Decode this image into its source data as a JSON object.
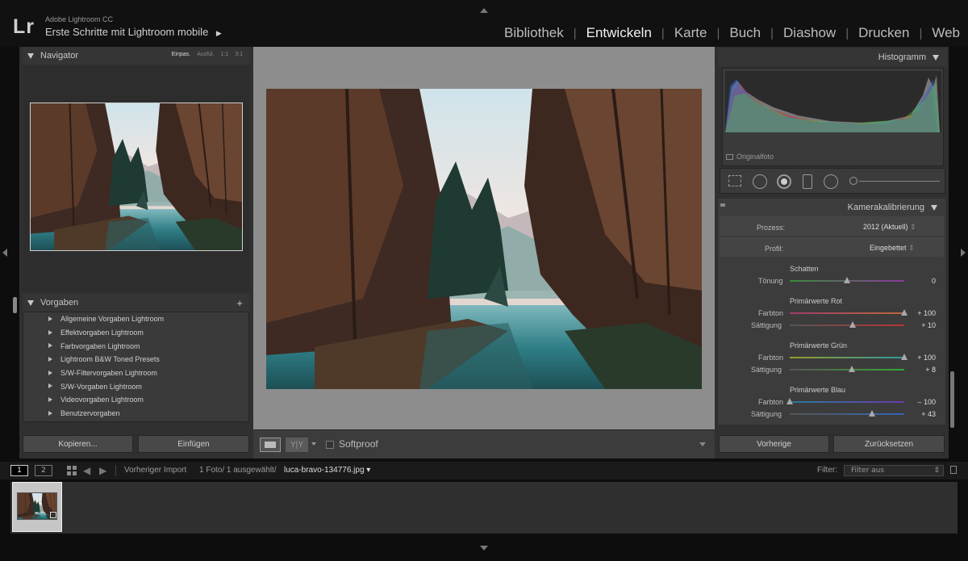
{
  "app": {
    "logo": "Lr",
    "name": "Adobe Lightroom CC",
    "catalog": "Erste Schritte mit Lightroom mobile",
    "modules": [
      "Bibliothek",
      "Entwickeln",
      "Karte",
      "Buch",
      "Diashow",
      "Drucken",
      "Web"
    ],
    "active_module": "Entwickeln"
  },
  "navigator": {
    "title": "Navigator",
    "zoom_options": [
      "Einpas.",
      "Ausfül.",
      "1:1",
      "3:1"
    ],
    "selected_zoom": "Einpas."
  },
  "presets": {
    "title": "Vorgaben",
    "add_symbol": "+",
    "items": [
      "Allgemeine Vorgaben Lightroom",
      "Effektvorgaben Lightroom",
      "Farbvorgaben Lightroom",
      "Lightroom B&W Toned Presets",
      "S/W-Filtervorgaben Lightroom",
      "S/W-Vorgaben Lightroom",
      "Videovorgaben Lightroom",
      "Benutzervorgaben"
    ]
  },
  "left_buttons": {
    "copy": "Kopieren...",
    "paste": "Einfügen"
  },
  "toolbar": {
    "softproof": "Softproof",
    "compare": "Y|Y"
  },
  "histogram": {
    "title": "Histogramm",
    "original_label": "Originalfoto"
  },
  "calibration": {
    "title": "Kamerakalibrierung",
    "process_label": "Prozess:",
    "process_value": "2012 (Aktuell)",
    "profile_label": "Profil:",
    "profile_value": "Eingebettet",
    "shadows": {
      "heading": "Schatten",
      "tint_label": "Tönung",
      "tint_value": "0",
      "tint_level": 0.5
    },
    "red": {
      "heading": "Primärwerte Rot",
      "hue_label": "Farbton",
      "hue_value": "+ 100",
      "hue_level": 1.0,
      "sat_label": "Sättigung",
      "sat_value": "+ 10",
      "sat_level": 0.55
    },
    "green": {
      "heading": "Primärwerte Grün",
      "hue_label": "Farbton",
      "hue_value": "+ 100",
      "hue_level": 1.0,
      "sat_label": "Sättigung",
      "sat_value": "+ 8",
      "sat_level": 0.54
    },
    "blue": {
      "heading": "Primärwerte Blau",
      "hue_label": "Farbton",
      "hue_value": "– 100",
      "hue_level": 0.0,
      "sat_label": "Sättigung",
      "sat_value": "+ 43",
      "sat_level": 0.72
    }
  },
  "right_buttons": {
    "previous": "Vorherige",
    "reset": "Zurücksetzen"
  },
  "filmstrip": {
    "views": [
      "1",
      "2"
    ],
    "source": "Vorheriger Import",
    "info": "1 Foto/ 1 ausgewählt/",
    "filename": "luca-bravo-134776.jpg",
    "filter_label": "Filter:",
    "filter_value": "Filter aus"
  },
  "icons": {
    "grid": "grid-icon",
    "back": "arrow-left-icon",
    "forward": "arrow-right-icon"
  }
}
